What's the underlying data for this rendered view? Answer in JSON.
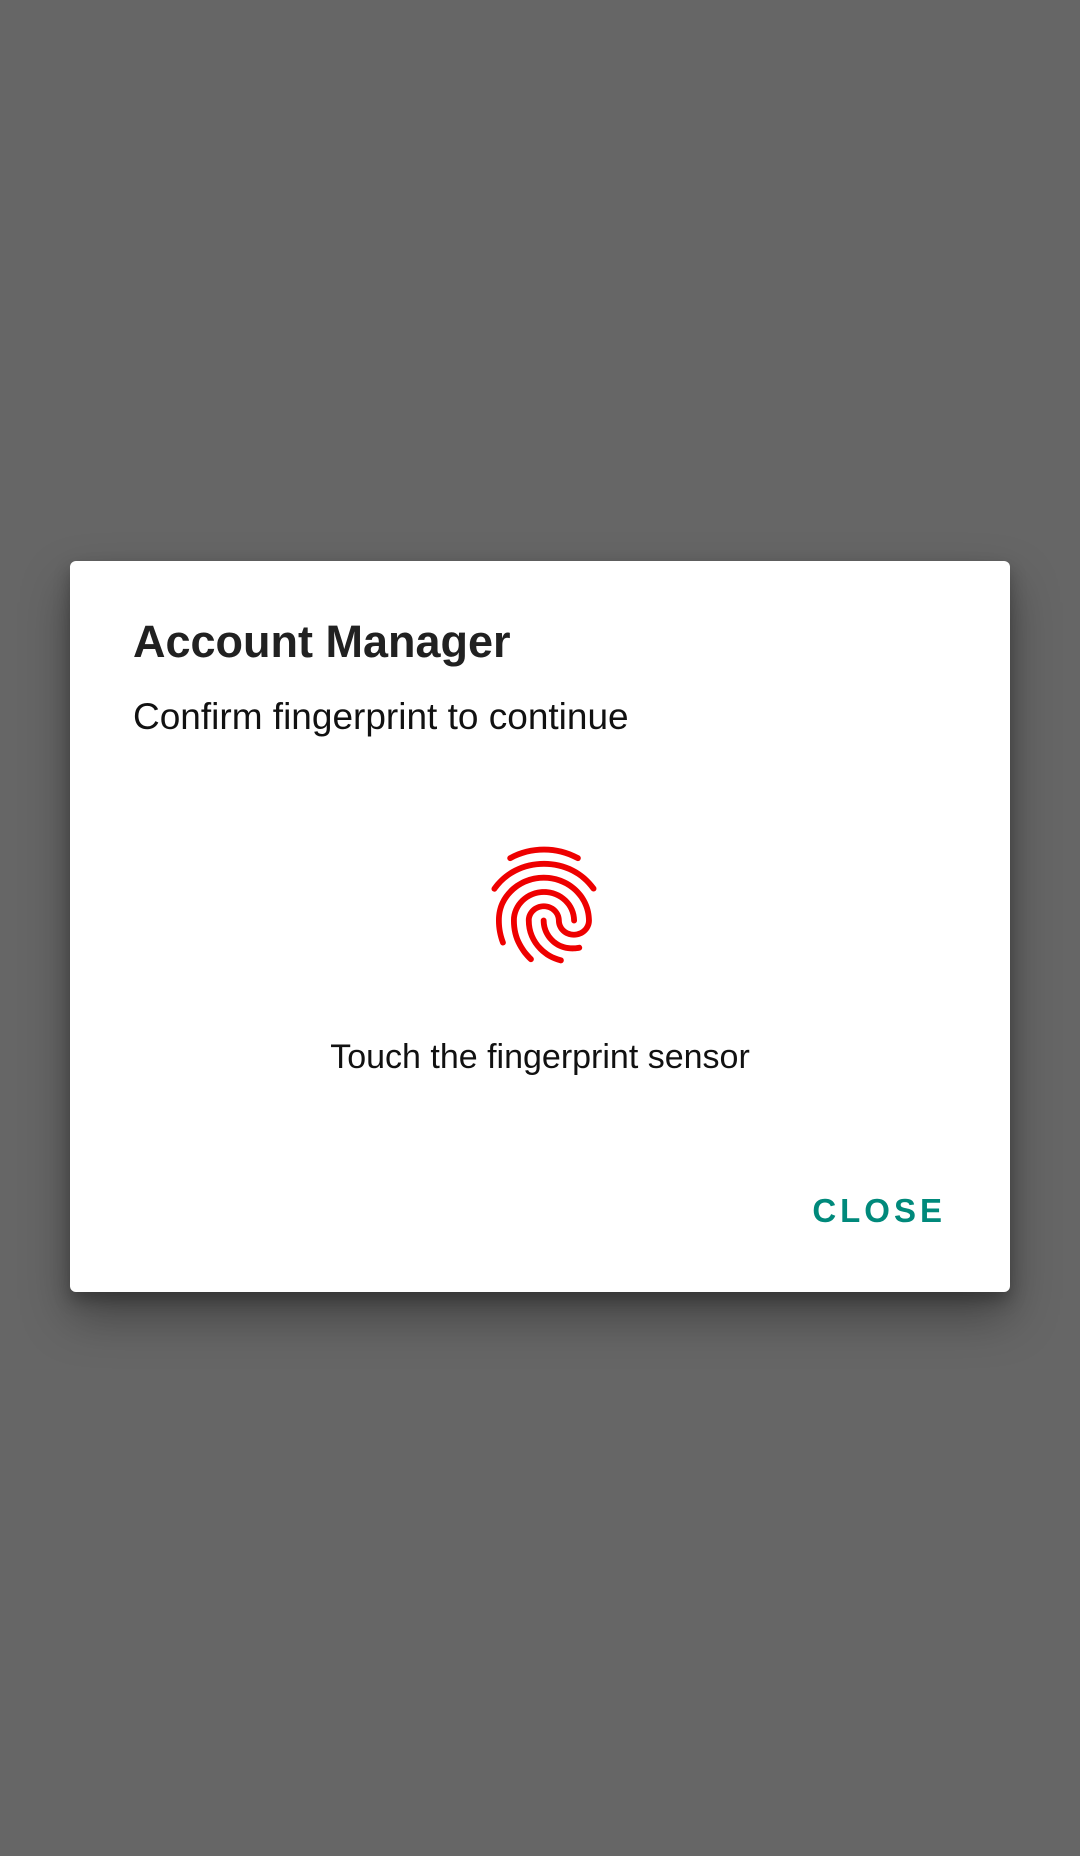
{
  "dialog": {
    "title": "Account Manager",
    "subtitle": "Confirm fingerprint to continue",
    "icon": "fingerprint-icon",
    "status_text": "Touch the fingerprint sensor",
    "close_label": "CLOSE"
  },
  "colors": {
    "scrim": "#666666",
    "dialog_background": "#ffffff",
    "fingerprint": "#ee0000",
    "accent": "#00897b"
  }
}
